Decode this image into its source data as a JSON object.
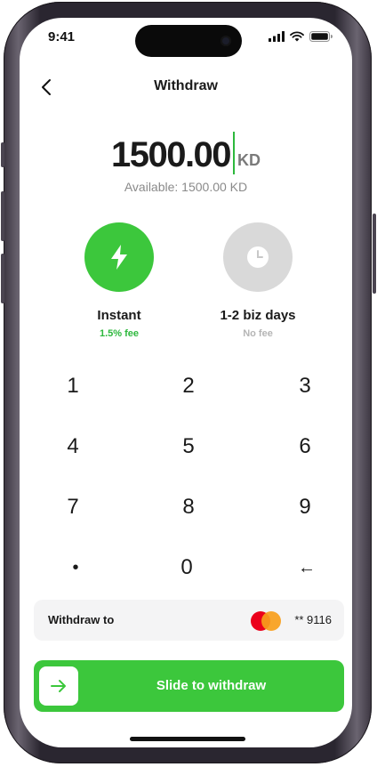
{
  "status_bar": {
    "time": "9:41"
  },
  "header": {
    "title": "Withdraw"
  },
  "amount": {
    "value": "1500.00",
    "currency": "KD",
    "available": "Available: 1500.00 KD"
  },
  "options": [
    {
      "title": "Instant",
      "subtitle": "1.5% fee",
      "icon": "lightning-icon",
      "selected": true,
      "color": "#3cc73c"
    },
    {
      "title": "1-2 biz days",
      "subtitle": "No fee",
      "icon": "clock-icon",
      "selected": false,
      "color": "#d9d9d9"
    }
  ],
  "keypad": {
    "keys": [
      "1",
      "2",
      "3",
      "4",
      "5",
      "6",
      "7",
      "8",
      "9",
      "•",
      "0",
      "←"
    ]
  },
  "withdraw_to": {
    "label": "Withdraw to",
    "card_number": "** 9116",
    "card_brand_icon": "mastercard-icon"
  },
  "slider": {
    "label": "Slide to withdraw",
    "icon": "arrow-right-icon"
  },
  "colors": {
    "accent": "#3cc73c",
    "text": "#1a1a1a",
    "muted": "#8a8a8a",
    "fee_green": "#2db83d",
    "no_fee": "#b5b5b5"
  }
}
